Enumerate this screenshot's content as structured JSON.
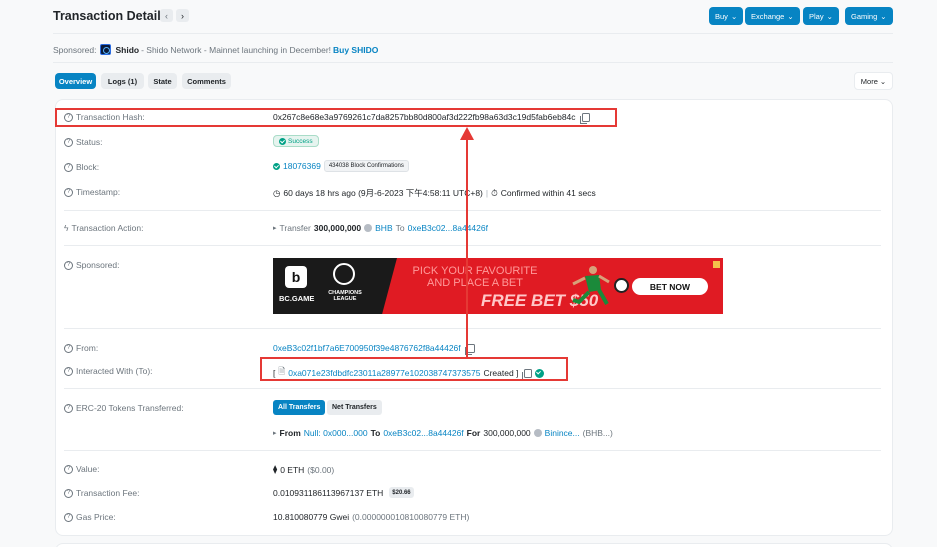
{
  "header": {
    "title": "Transaction Details",
    "prev_icon": "chevron-left-icon",
    "next_icon": "chevron-right-icon",
    "buttons": [
      "Buy",
      "Exchange",
      "Play",
      "Gaming"
    ]
  },
  "sponsored": {
    "prefix": "Sponsored:",
    "name": "Shido",
    "text": " - Shido Network - Mainnet launching in December!",
    "cta": "Buy SHIDO"
  },
  "tabs": [
    "Overview",
    "Logs (1)",
    "State",
    "Comments"
  ],
  "more_label": "More",
  "rows": {
    "hash": {
      "label": "Transaction Hash:",
      "value": "0x267c8e68e3a9769261c7da8257bb80d800af3d222fb98a63d3c19d5fab6eb84c"
    },
    "status": {
      "label": "Status:",
      "value": "Success"
    },
    "block": {
      "label": "Block:",
      "value": "18076369",
      "confirmations": "434038 Block Confirmations"
    },
    "timestamp": {
      "label": "Timestamp:",
      "value": "60 days 18 hrs ago (9月-6-2023 下午4:58:11 UTC+8)",
      "confirmed": "Confirmed within 41 secs"
    },
    "action": {
      "label": "Transaction Action:",
      "prefix": "Transfer",
      "amount": "300,000,000",
      "token": "BHB",
      "to_word": "To",
      "to": "0xeB3c02...8a44426f"
    },
    "sponsored": {
      "label": "Sponsored:"
    },
    "from": {
      "label": "From:",
      "value": "0xeB3c02f1bf7a6E700950f39e4876762f8a44426f"
    },
    "interacted": {
      "label": "Interacted With (To):",
      "open": "[",
      "contract": "0xa071e23fdbdfc23011a28977e102038747373575",
      "created": "Created ]"
    },
    "erc20": {
      "label": "ERC-20 Tokens Transferred:",
      "btn_all": "All Transfers",
      "btn_net": "Net Transfers",
      "from_word": "From",
      "null_addr": "Null: 0x000...000",
      "to_word": "To",
      "to_addr": "0xeB3c02...8a44426f",
      "for_word": "For",
      "amount": "300,000,000",
      "token": "Binince...",
      "token_sym": "(BHB...)"
    },
    "value": {
      "label": "Value:",
      "value": "0 ETH",
      "usd": "($0.00)"
    },
    "fee": {
      "label": "Transaction Fee:",
      "value": "0.010931186113967137 ETH",
      "usd": "$20.66"
    },
    "gas": {
      "label": "Gas Price:",
      "value": "10.810080779 Gwei",
      "detail": "(0.000000010810080779 ETH)"
    }
  },
  "banner": {
    "brand": "BC.GAME",
    "league": "CHAMPIONS LEAGUE",
    "headline": "PICK YOUR FAVOURITE AND PLACE A BET",
    "free_bet": "FREE BET $50",
    "cta": "BET NOW"
  },
  "colors": {
    "accent": "#0784c3",
    "success": "#00a186",
    "annotation": "#e53935"
  }
}
